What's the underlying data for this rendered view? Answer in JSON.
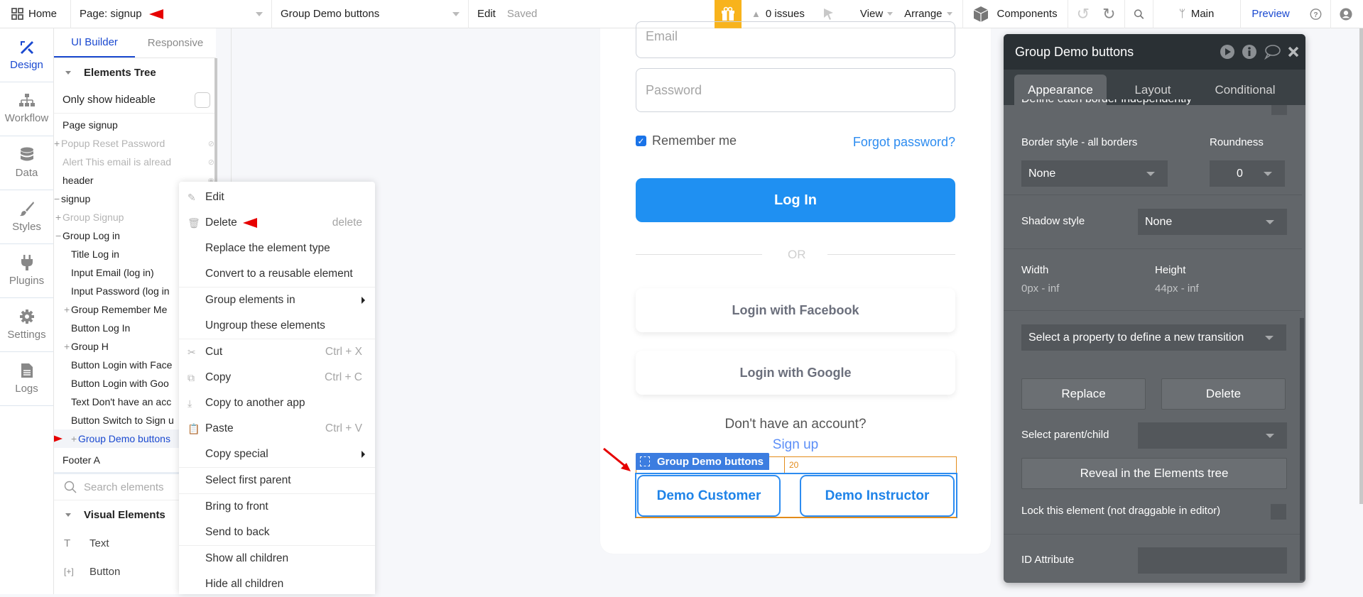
{
  "topbar": {
    "home_label": "Home",
    "page_label": "Page: signup",
    "element_label": "Group Demo buttons",
    "edit_label": "Edit",
    "saved_label": "Saved",
    "issues_label": "0 issues",
    "view_label": "View",
    "arrange_label": "Arrange",
    "components_label": "Components",
    "branch_label": "Main",
    "preview_label": "Preview"
  },
  "iconbar": {
    "items": [
      {
        "label": "Design",
        "icon": "design-icon",
        "active": true
      },
      {
        "label": "Workflow",
        "icon": "workflow-icon"
      },
      {
        "label": "Data",
        "icon": "data-icon"
      },
      {
        "label": "Styles",
        "icon": "styles-icon"
      },
      {
        "label": "Plugins",
        "icon": "plugins-icon"
      },
      {
        "label": "Settings",
        "icon": "settings-icon"
      },
      {
        "label": "Logs",
        "icon": "logs-icon"
      }
    ]
  },
  "leftpanel": {
    "tabs": [
      "UI Builder",
      "Responsive"
    ],
    "elements_tree_title": "Elements Tree",
    "only_show_hideable": "Only show hideable",
    "tree": [
      {
        "label": "Page signup",
        "indent": 0,
        "prefix": ""
      },
      {
        "label": "Popup Reset Password",
        "indent": 0,
        "prefix": "+",
        "dim": true,
        "eye": "hidden"
      },
      {
        "label": "Alert This email is alread",
        "indent": 0,
        "prefix": "",
        "dim": true,
        "eye": "hidden"
      },
      {
        "label": "header",
        "indent": 0,
        "prefix": "",
        "eye": "visible"
      },
      {
        "label": "signup",
        "indent": 0,
        "prefix": "−"
      },
      {
        "label": "Group Signup",
        "indent": 1,
        "prefix": "+",
        "dim": true
      },
      {
        "label": "Group Log in",
        "indent": 1,
        "prefix": "−"
      },
      {
        "label": "Title Log in",
        "indent": 2,
        "prefix": ""
      },
      {
        "label": "Input Email (log in)",
        "indent": 2,
        "prefix": ""
      },
      {
        "label": "Input Password (log in",
        "indent": 2,
        "prefix": ""
      },
      {
        "label": "Group Remember Me",
        "indent": 2,
        "prefix": "+"
      },
      {
        "label": "Button Log In",
        "indent": 2,
        "prefix": ""
      },
      {
        "label": "Group H",
        "indent": 2,
        "prefix": "+"
      },
      {
        "label": "Button Login with Face",
        "indent": 2,
        "prefix": ""
      },
      {
        "label": "Button Login with Goo",
        "indent": 2,
        "prefix": ""
      },
      {
        "label": "Text Don't have an acc",
        "indent": 2,
        "prefix": ""
      },
      {
        "label": "Button Switch to Sign u",
        "indent": 2,
        "prefix": ""
      },
      {
        "label": "Group Demo buttons",
        "indent": 2,
        "prefix": "+",
        "selected": true
      },
      {
        "label": "Footer A",
        "indent": 0,
        "prefix": ""
      }
    ],
    "search_placeholder": "Search elements",
    "visual_elements_title": "Visual Elements",
    "visual_elements": [
      {
        "label": "Text",
        "icon": "T"
      },
      {
        "label": "Button",
        "icon": "[+]"
      }
    ]
  },
  "context_menu": {
    "groups": [
      [
        {
          "label": "Edit",
          "icon": "edit-icon",
          "glyph": "✎"
        },
        {
          "label": "Delete",
          "icon": "trash-icon",
          "glyph": "🗑",
          "shortcut": "delete",
          "annotated": true
        },
        {
          "label": "Replace the element type"
        },
        {
          "label": "Convert to a reusable element"
        }
      ],
      [
        {
          "label": "Group elements in",
          "submenu": true
        },
        {
          "label": "Ungroup these elements"
        }
      ],
      [
        {
          "label": "Cut",
          "icon": "scissors-icon",
          "glyph": "✂",
          "shortcut": "Ctrl + X"
        },
        {
          "label": "Copy",
          "icon": "copy-icon",
          "glyph": "⧉",
          "shortcut": "Ctrl + C"
        },
        {
          "label": "Copy to another app",
          "icon": "download-icon",
          "glyph": "⤓"
        },
        {
          "label": "Paste",
          "icon": "paste-icon",
          "glyph": "📋",
          "shortcut": "Ctrl + V"
        },
        {
          "label": "Copy special",
          "submenu": true
        }
      ],
      [
        {
          "label": "Select first parent"
        }
      ],
      [
        {
          "label": "Bring to front"
        },
        {
          "label": "Send to back"
        }
      ],
      [
        {
          "label": "Show all children"
        },
        {
          "label": "Hide all children"
        }
      ]
    ]
  },
  "canvas": {
    "email_placeholder": "Email",
    "password_placeholder": "Password",
    "remember_me": "Remember me",
    "remember_checked": true,
    "forgot_password": "Forgot password?",
    "login_button": "Log In",
    "or_label": "OR",
    "facebook_button": "Login with Facebook",
    "google_button": "Login with Google",
    "no_account": "Don't have an account?",
    "sign_up": "Sign up",
    "group_badge": "Group Demo buttons",
    "spacing_value": "20",
    "demo_customer": "Demo Customer",
    "demo_instructor": "Demo Instructor"
  },
  "property_panel": {
    "title": "Group Demo buttons",
    "tabs": [
      "Appearance",
      "Layout",
      "Conditional"
    ],
    "active_tab": "Appearance",
    "define_each_border": "Define each border independently",
    "border_style_label": "Border style - all borders",
    "border_style_value": "None",
    "roundness_label": "Roundness",
    "roundness_value": "0",
    "shadow_style_label": "Shadow style",
    "shadow_style_value": "None",
    "width_label": "Width",
    "width_value": "0px - inf",
    "height_label": "Height",
    "height_value": "44px - inf",
    "transition_placeholder": "Select a property to define a new transition",
    "replace_button": "Replace",
    "delete_button": "Delete",
    "select_parent_child_label": "Select parent/child",
    "select_parent_child_value": "",
    "reveal_button": "Reveal in the Elements tree",
    "lock_label": "Lock this element (not draggable in editor)",
    "id_attribute_label": "ID Attribute",
    "id_attribute_value": ""
  },
  "colors": {
    "accent_blue": "#1a49d0",
    "bubble_primary": "#1f90f2",
    "gift_yellow": "#f8b31c",
    "panel_dark": "#2a3034",
    "panel_body": "#62666a",
    "annotation_red": "#e60000",
    "selection_orange": "#e38b1a"
  }
}
